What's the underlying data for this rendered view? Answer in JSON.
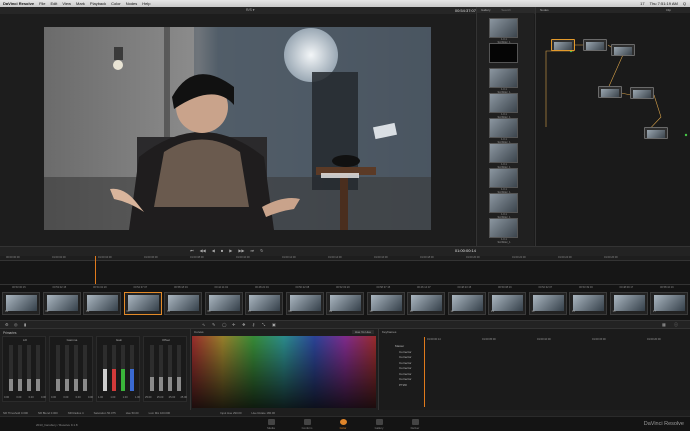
{
  "menubar": {
    "app": "DaVinci Resolve",
    "items": [
      "File",
      "Edit",
      "View",
      "Mark",
      "Playback",
      "Color",
      "Nodes",
      "Help"
    ],
    "right": [
      "17",
      "Thu 7:51:19 AM",
      "Q"
    ]
  },
  "viewer": {
    "title": "R/S ▾",
    "timecode": "00:54:37:07"
  },
  "gallery": {
    "title": "Gallery",
    "search_placeholder": "Search",
    "stills": [
      {
        "label": "1.0.1\nScribbler_1"
      },
      {
        "label": ""
      },
      {
        "label": "1.0.1\nScribbler_1"
      },
      {
        "label": "1.0.1\nScribbler_1"
      },
      {
        "label": "1.0.1\nScribbler_1"
      },
      {
        "label": "1.0.1\nScribbler_1"
      },
      {
        "label": "1.0.1\nScribbler_1"
      },
      {
        "label": "1.0.1\nScribbler_1"
      },
      {
        "label": "1.0.1\nScribbler_1"
      }
    ]
  },
  "nodes": {
    "title": "Nodes",
    "clip_label": "Clip"
  },
  "transport": {
    "timecode": "01:00:00:14"
  },
  "ruler": {
    "ticks": [
      "00:00:00:00",
      "01:00:02:00",
      "01:00:04:00",
      "01:00:06:00",
      "01:00:08:00",
      "01:00:10:00",
      "01:00:12:00",
      "01:00:14:00",
      "01:00:16:00",
      "01:00:18:00",
      "01:00:20:00",
      "01:00:22:00",
      "01:00:24:00",
      "01:00:26:00"
    ]
  },
  "clips": [
    {
      "tc": "00:53:00:15",
      "num": "01"
    },
    {
      "tc": "00:53:02:15",
      "num": "02"
    },
    {
      "tc": "00:54:02:20",
      "num": "03"
    },
    {
      "tc": "00:54:37:07",
      "num": "04"
    },
    {
      "tc": "00:58:18:04",
      "num": "05"
    },
    {
      "tc": "00:44:11:02",
      "num": "06"
    },
    {
      "tc": "00:48:22:04",
      "num": "07"
    },
    {
      "tc": "00:50:22:08",
      "num": "08"
    },
    {
      "tc": "00:52:03:20",
      "num": "09"
    },
    {
      "tc": "00:58:37:15",
      "num": "10"
    },
    {
      "tc": "00:46:14:07",
      "num": "11"
    },
    {
      "tc": "00:48:23:15",
      "num": "12"
    },
    {
      "tc": "00:50:08:16",
      "num": "13"
    },
    {
      "tc": "00:52:32:07",
      "num": "14"
    },
    {
      "tc": "00:53:39:03",
      "num": "15"
    },
    {
      "tc": "00:48:09:17",
      "num": "16"
    },
    {
      "tc": "00:58:10:16",
      "num": "17"
    }
  ],
  "primaries": {
    "title": "Primaries",
    "wheels": [
      {
        "name": "Lift",
        "vals": [
          "0.00",
          "0.00",
          "0.00",
          "0.00"
        ]
      },
      {
        "name": "Gamma",
        "vals": [
          "0.00",
          "0.00",
          "0.00",
          "0.00"
        ]
      },
      {
        "name": "Gain",
        "vals": [
          "1.00",
          "1.00",
          "1.00",
          "1.00"
        ]
      },
      {
        "name": "Offset",
        "vals": [
          "25.00",
          "25.00",
          "25.00",
          "25.00"
        ]
      }
    ]
  },
  "curves": {
    "title": "Curves",
    "mode": "Hue Vs Hue"
  },
  "keyframes": {
    "title": "Keyframes",
    "tcs": [
      "01:00:00:14",
      "01:00:05:00",
      "01:00:10:00",
      "01:00:15:00",
      "01:00:20:00"
    ],
    "rows": [
      "Master",
      "Corrector",
      "Corrector",
      "Corrector",
      "Corrector",
      "Corrector",
      "Corrector",
      "PTZR"
    ]
  },
  "readouts": [
    "NR Threshold 0.000",
    "NR Blend 0.000",
    "NR Radius 4",
    "Saturation 50.075",
    "Hue 50.00",
    "Lum Mix 100.000",
    "Input Hue 290.00",
    "Hue Rotate 180.00"
  ],
  "pages": [
    "Media",
    "Conform",
    "Color",
    "Gallery",
    "Deliver"
  ],
  "active_page": "Color",
  "project": "2013_hansbury / Resolve 9.1.8",
  "brand": "DaVinci Resolve"
}
